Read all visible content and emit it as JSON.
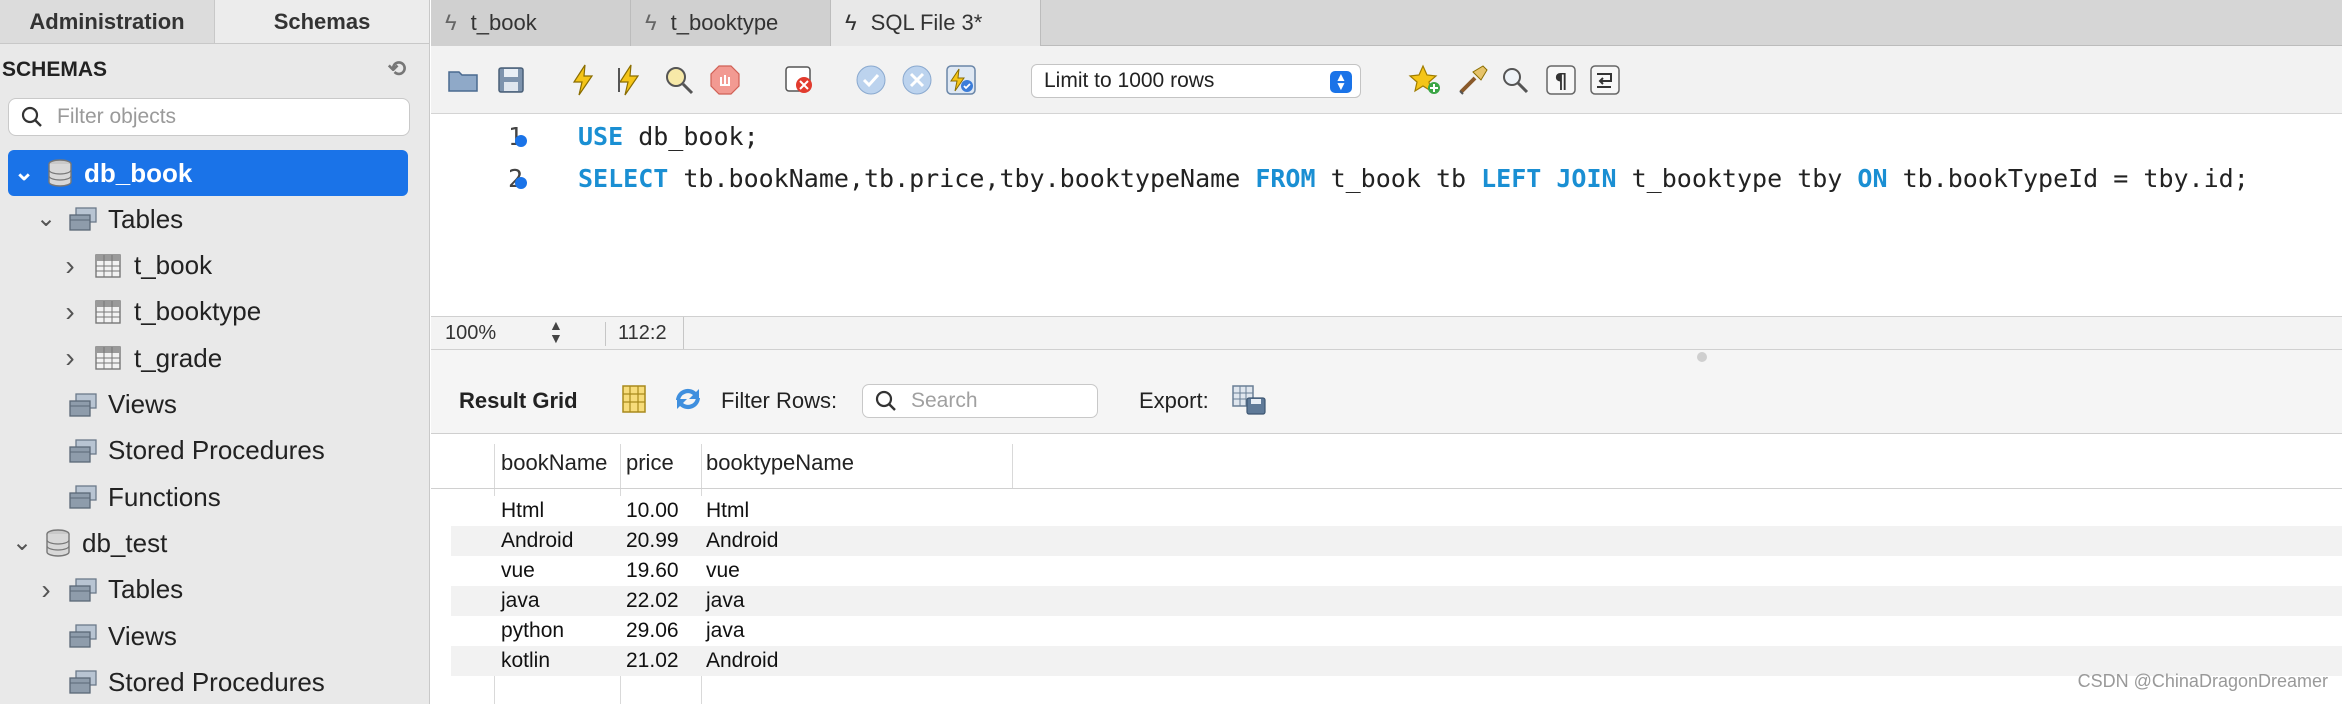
{
  "sidebar": {
    "tabs": [
      "Administration",
      "Schemas"
    ],
    "header": "SCHEMAS",
    "filter_placeholder": "Filter objects",
    "tree": [
      {
        "label": "db_book",
        "kind": "db",
        "chevron": "open",
        "selected": true
      },
      {
        "label": "Tables",
        "kind": "folder",
        "chevron": "open"
      },
      {
        "label": "t_book",
        "kind": "table",
        "chevron": "closed"
      },
      {
        "label": "t_booktype",
        "kind": "table",
        "chevron": "closed"
      },
      {
        "label": "t_grade",
        "kind": "table",
        "chevron": "closed"
      },
      {
        "label": "Views",
        "kind": "folder",
        "chevron": "none"
      },
      {
        "label": "Stored Procedures",
        "kind": "folder",
        "chevron": "none"
      },
      {
        "label": "Functions",
        "kind": "folder",
        "chevron": "none"
      },
      {
        "label": "db_test",
        "kind": "db",
        "chevron": "open"
      },
      {
        "label": "Tables",
        "kind": "folder",
        "chevron": "closed"
      },
      {
        "label": "Views",
        "kind": "folder",
        "chevron": "none"
      },
      {
        "label": "Stored Procedures",
        "kind": "folder",
        "chevron": "none"
      }
    ]
  },
  "tabs": [
    {
      "label": "t_book",
      "icon": "bolt-icon"
    },
    {
      "label": "t_booktype",
      "icon": "bolt-icon"
    },
    {
      "label": "SQL File 3*",
      "icon": "bolt-icon",
      "active": true
    }
  ],
  "toolbar": {
    "limit_label": "Limit to 1000 rows"
  },
  "editor": {
    "line_numbers": [
      "1",
      "2"
    ],
    "line1": {
      "kw": "USE",
      "rest": " db_book;"
    },
    "line2": [
      {
        "t": "SELECT",
        "kw": true
      },
      {
        "t": " tb.bookName,tb.price,tby.booktypeName ",
        "kw": false
      },
      {
        "t": "FROM",
        "kw": true
      },
      {
        "t": " t_book tb ",
        "kw": false
      },
      {
        "t": "LEFT JOIN",
        "kw": true
      },
      {
        "t": " t_booktype tby ",
        "kw": false
      },
      {
        "t": "ON",
        "kw": true
      },
      {
        "t": " tb.bookTypeId = tby.id;",
        "kw": false
      }
    ]
  },
  "status": {
    "zoom": "100%",
    "position": "112:2"
  },
  "result": {
    "grid_label": "Result Grid",
    "filter_label": "Filter Rows:",
    "search_placeholder": "Search",
    "export_label": "Export:",
    "columns": [
      "bookName",
      "price",
      "booktypeName"
    ],
    "rows": [
      [
        "Html",
        "10.00",
        "Html"
      ],
      [
        "Android",
        "20.99",
        "Android"
      ],
      [
        "vue",
        "19.60",
        "vue"
      ],
      [
        "java",
        "22.02",
        "java"
      ],
      [
        "python",
        "29.06",
        "java"
      ],
      [
        "kotlin",
        "21.02",
        "Android"
      ]
    ]
  },
  "watermark": "CSDN @ChinaDragonDreamer",
  "colors": {
    "accent": "#1a73e8",
    "keyword": "#1a8fd3",
    "underline": "#e02020"
  }
}
